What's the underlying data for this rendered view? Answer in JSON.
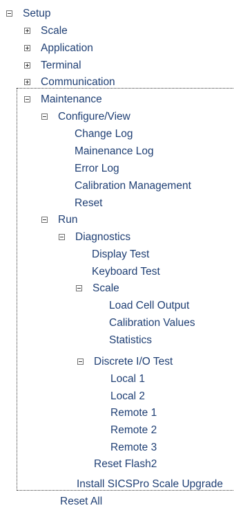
{
  "tree": {
    "setup": {
      "label": "Setup",
      "state": "expanded"
    },
    "scale": {
      "label": "Scale",
      "state": "collapsed"
    },
    "application": {
      "label": "Application",
      "state": "collapsed"
    },
    "terminal": {
      "label": "Terminal",
      "state": "collapsed"
    },
    "communication": {
      "label": "Communication",
      "state": "collapsed"
    },
    "maintenance": {
      "label": "Maintenance",
      "state": "expanded"
    },
    "configure_view": {
      "label": "Configure/View",
      "state": "expanded"
    },
    "change_log": {
      "label": "Change Log"
    },
    "maintenance_log": {
      "label": "Mainenance Log"
    },
    "error_log": {
      "label": "Error Log"
    },
    "calibration_management": {
      "label": "Calibration Management"
    },
    "reset": {
      "label": "Reset"
    },
    "run": {
      "label": "Run",
      "state": "expanded"
    },
    "diagnostics": {
      "label": "Diagnostics",
      "state": "expanded"
    },
    "display_test": {
      "label": "Display Test"
    },
    "keyboard_test": {
      "label": "Keyboard Test"
    },
    "diag_scale": {
      "label": "Scale",
      "state": "expanded"
    },
    "load_cell_output": {
      "label": "Load Cell Output"
    },
    "calibration_values": {
      "label": "Calibration Values"
    },
    "statistics": {
      "label": "Statistics"
    },
    "discrete_io_test": {
      "label": "Discrete I/O Test",
      "state": "expanded"
    },
    "local_1": {
      "label": "Local 1"
    },
    "local_2": {
      "label": "Local 2"
    },
    "remote_1": {
      "label": "Remote 1"
    },
    "remote_2": {
      "label": "Remote 2"
    },
    "remote_3": {
      "label": "Remote 3"
    },
    "reset_flash2": {
      "label": "Reset Flash2"
    },
    "install_upgrade": {
      "label": "Install SICSPro Scale Upgrade"
    },
    "reset_all": {
      "label": "Reset All"
    }
  },
  "colors": {
    "text": "#1f3f74",
    "toggle_border": "#6f6f6f",
    "focus_outline": "#333333"
  },
  "icons": {
    "expanded": "minus-box-icon",
    "collapsed": "plus-box-icon"
  }
}
